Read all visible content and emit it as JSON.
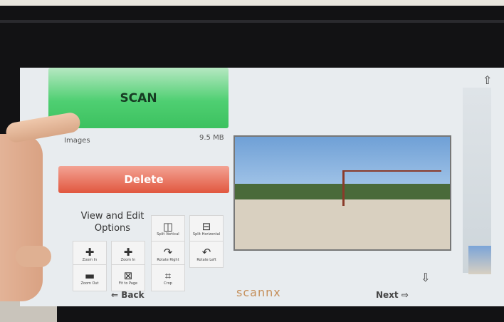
{
  "scan": {
    "label": "SCAN"
  },
  "status": {
    "images": "Images",
    "size": "9.5 MB"
  },
  "delete": {
    "label": "Delete"
  },
  "edit_options": {
    "title": "View and Edit Options"
  },
  "tools": [
    {
      "label": "Split Vertical",
      "icon": "split-vertical-icon"
    },
    {
      "label": "Split Horizontal",
      "icon": "split-horizontal-icon"
    },
    {
      "label": "Zoom In",
      "icon": "zoom-in-icon"
    },
    {
      "label": "Zoom In",
      "icon": "zoom-in-icon"
    },
    {
      "label": "Rotate Right",
      "icon": "rotate-right-icon"
    },
    {
      "label": "Rotate Left",
      "icon": "rotate-left-icon"
    },
    {
      "label": "Zoom Out",
      "icon": "zoom-out-icon"
    },
    {
      "label": "Fit to Page",
      "icon": "fit-to-page-icon"
    },
    {
      "label": "Crop",
      "icon": "crop-icon"
    }
  ],
  "nav": {
    "back": "Back",
    "next": "Next"
  },
  "brand": "scannx",
  "colors": {
    "scan": "#3cc15f",
    "delete": "#e1573f"
  }
}
